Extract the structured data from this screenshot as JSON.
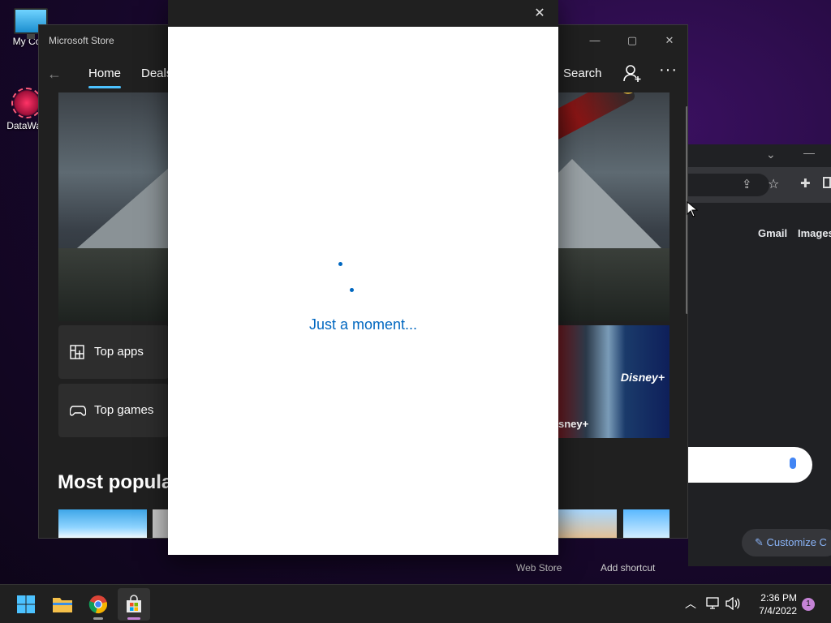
{
  "desktop": {
    "icons": [
      {
        "label": "My Com",
        "icon": "monitor-icon"
      },
      {
        "label": "DataWag",
        "icon": "datawag-icon"
      }
    ]
  },
  "chrome": {
    "links": [
      "Gmail",
      "Images"
    ],
    "customize_label": "Customize C",
    "footer": [
      "Web Store",
      "Add shortcut"
    ]
  },
  "store": {
    "title": "Microsoft Store",
    "tabs": [
      "Home",
      "Deals"
    ],
    "search_label": "Search",
    "more_label": "···",
    "tiles": [
      {
        "label": "Top apps",
        "icon": "grid-icon"
      },
      {
        "label": "Top games",
        "icon": "gamepad-icon"
      }
    ],
    "promo_brand": "Disney+",
    "promo_caption": "sney+",
    "section_title": "Most popula"
  },
  "dialog": {
    "loading_text": "Just a moment..."
  },
  "taskbar": {
    "clock_time": "2:36 PM",
    "clock_date": "7/4/2022",
    "notification_count": "1"
  },
  "colors": {
    "accent": "#0067c0",
    "store_tab_underline": "#4cc2ff",
    "taskbar_bg": "#202020"
  }
}
